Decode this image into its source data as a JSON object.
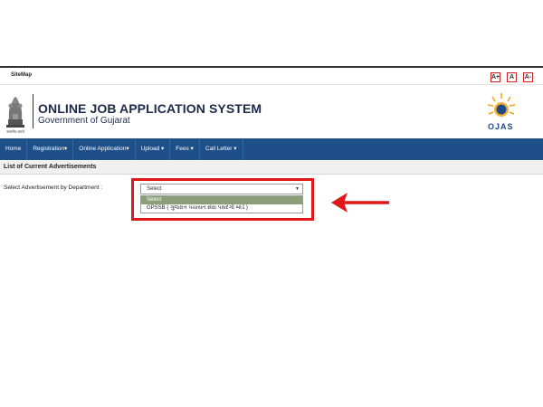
{
  "topbar": {
    "sitemap_label": "SiteMap",
    "font_buttons": [
      "A+",
      "A",
      "A-"
    ]
  },
  "header": {
    "emblem_caption": "सत्यमेव जयते",
    "title": "ONLINE JOB APPLICATION SYSTEM",
    "subtitle": "Government of Gujarat",
    "logo_text": "OJAS"
  },
  "nav": {
    "items": [
      "Home",
      "Registration▾",
      "Online Application▾",
      "Upload ▾",
      "Fees ▾",
      "Call Letter ▾"
    ]
  },
  "section": {
    "title": "List of Current Advertisements"
  },
  "form": {
    "label": "Select Advertisement by Department :",
    "select_value": "Select",
    "options": [
      "Select",
      "GPSSB ( ગુજરાત પંચાયત સેવા પસંદગી બોર્ડ )"
    ]
  },
  "colors": {
    "nav_bg": "#1f4f88",
    "highlight_border": "#e01818",
    "selected_option": "#8a9f78"
  }
}
